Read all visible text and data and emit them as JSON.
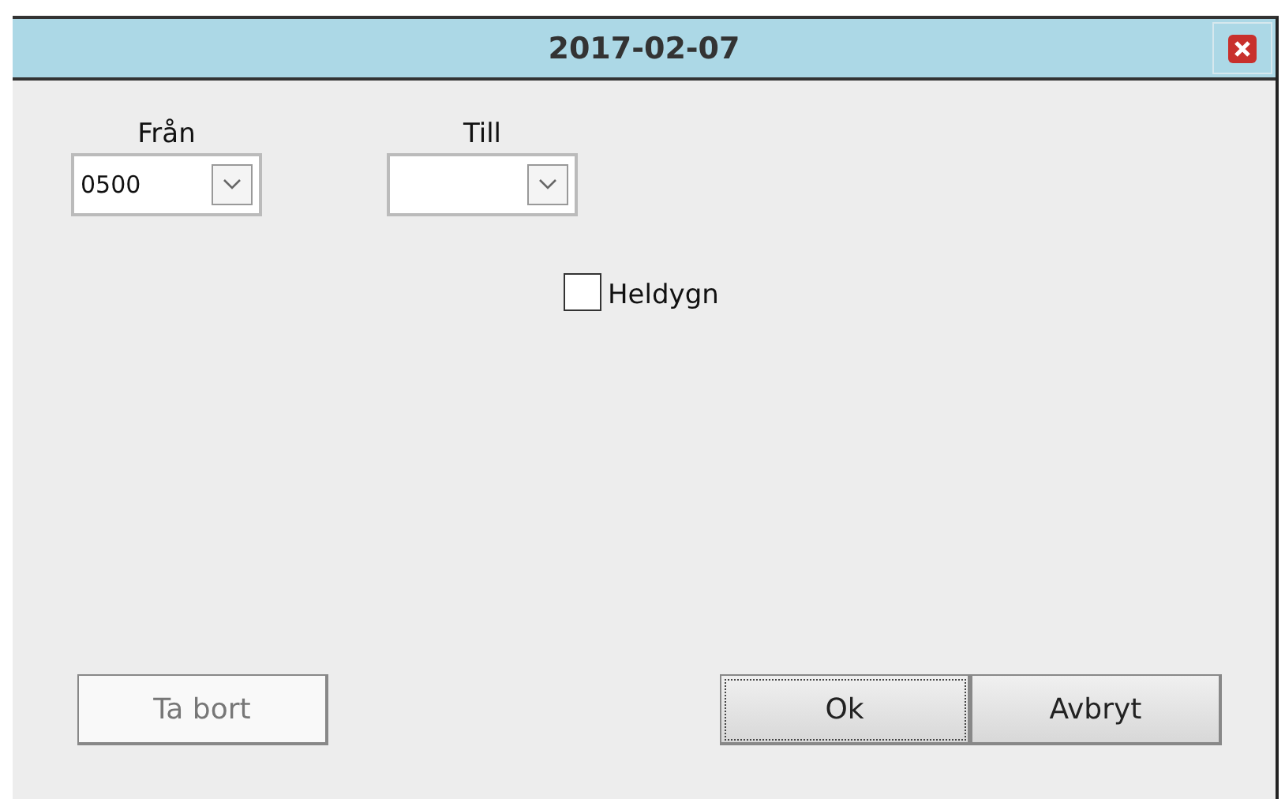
{
  "window": {
    "title": "2017-02-07"
  },
  "fields": [
    {
      "label": "Från",
      "value": "0500"
    },
    {
      "label": "Till"
    }
  ],
  "checkbox": {
    "label": "Heldygn",
    "checked": false
  },
  "left_buttons": [
    {
      "label": "Ta bort",
      "disabled": true,
      "focused": false
    }
  ],
  "right_buttons": [
    {
      "label": "Ok",
      "disabled": false,
      "focused": true
    },
    {
      "label": "Avbryt",
      "disabled": false,
      "focused": false
    }
  ]
}
